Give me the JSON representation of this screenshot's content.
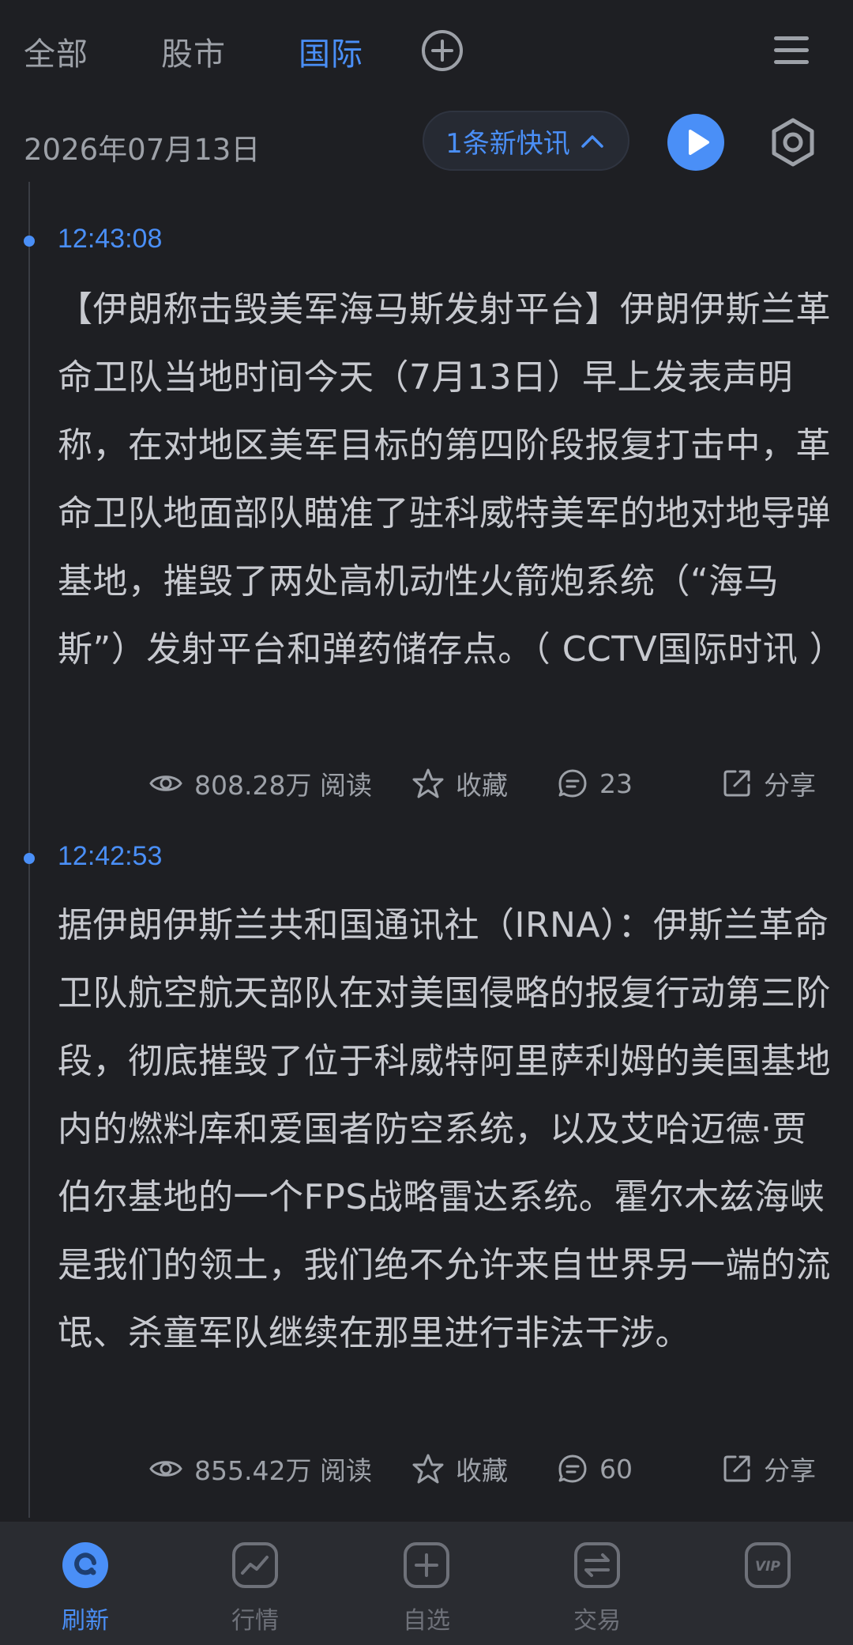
{
  "tabs": [
    {
      "label": "全部",
      "active": false
    },
    {
      "label": "股市",
      "active": false
    },
    {
      "label": "国际",
      "active": true
    }
  ],
  "date": "2026年07月13日",
  "new_news_label": "1条新快讯",
  "colors": {
    "background": "#1e1f23",
    "accent": "#4a8ff7",
    "text": "#c7c9cf",
    "muted": "#9da1a8",
    "nav_bg": "#2a2c31"
  },
  "news": [
    {
      "time": "12:43:08",
      "content": "【伊朗称击毁美军海马斯发射平台】伊朗伊斯兰革命卫队当地时间今天（7月13日）早上发表声明称，在对地区美军目标的第四阶段报复打击中，革命卫队地面部队瞄准了驻科威特美军的地对地导弹基地，摧毁了两处高机动性火箭炮系统（“海马斯”）发射平台和弹药储存点。（ CCTV国际时讯 ）",
      "reads": "808.28万 阅读",
      "favorite": "收藏",
      "comments": "23",
      "share": "分享"
    },
    {
      "time": "12:42:53",
      "content": "据伊朗伊斯兰共和国通讯社（IRNA）：伊斯兰革命卫队航空航天部队在对美国侵略的报复行动第三阶段，彻底摧毁了位于科威特阿里萨利姆的美国基地内的燃料库和爱国者防空系统，以及艾哈迈德·贾伯尔基地的一个FPS战略雷达系统。霍尔木兹海峡是我们的领土，我们绝不允许来自世界另一端的流氓、杀童军队继续在那里进行非法干涉。",
      "reads": "855.42万 阅读",
      "favorite": "收藏",
      "comments": "60",
      "share": "分享"
    }
  ],
  "bottom_nav": [
    {
      "label": "刷新",
      "icon": "refresh-icon",
      "active": true
    },
    {
      "label": "行情",
      "icon": "chart-icon",
      "active": false
    },
    {
      "label": "自选",
      "icon": "add-square-icon",
      "active": false
    },
    {
      "label": "交易",
      "icon": "exchange-icon",
      "active": false
    },
    {
      "label": "VIP",
      "icon": "vip-icon",
      "active": false
    }
  ]
}
